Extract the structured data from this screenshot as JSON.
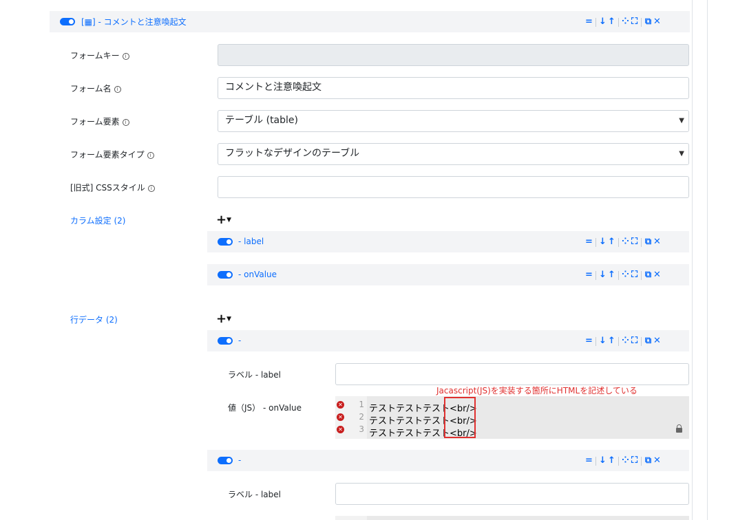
{
  "main_form": {
    "title": "[▦] - コメントと注意喚起文",
    "fields": {
      "form_key": {
        "label": "フォームキー",
        "value": ""
      },
      "form_name": {
        "label": "フォーム名",
        "value": "コメントと注意喚起文"
      },
      "form_element": {
        "label": "フォーム要素",
        "value": "テーブル (table)"
      },
      "form_element_type": {
        "label": "フォーム要素タイプ",
        "value": "フラットなデザインのテーブル"
      },
      "css_style": {
        "label": "[旧式] CSSスタイル",
        "value": ""
      }
    }
  },
  "toolbar": {
    "move": "=",
    "down": "↓",
    "up": "↑",
    "collapse": "⁘",
    "expand": "⛶",
    "copy": "⧉",
    "delete": "✕"
  },
  "columns": {
    "label": "カラム設定 (2)",
    "add_label": "+",
    "items": [
      {
        "title": "- label"
      },
      {
        "title": "- onValue"
      }
    ]
  },
  "rows": {
    "label": "行データ (2)",
    "add_label": "+",
    "items": [
      {
        "title": "-",
        "label_field": {
          "label": "ラベル - label",
          "value": ""
        },
        "value_field": {
          "label": "値（JS） - onValue",
          "lines": [
            {
              "num": "1",
              "text": "テストテストテスト",
              "tag": "<br/>"
            },
            {
              "num": "2",
              "text": "テストテストテスト",
              "tag": "<br/>"
            },
            {
              "num": "3",
              "text": "テストテストテスト",
              "tag": "<br/>"
            }
          ]
        }
      },
      {
        "title": "-",
        "label_field": {
          "label": "ラベル - label",
          "value": ""
        }
      }
    ]
  },
  "annotation": "Jacascript(JS)を実装する箇所にHTMLを記述している",
  "colors": {
    "accent": "#0d6efd",
    "annotation": "#e0302f",
    "header_bg": "#f3f4f6"
  }
}
